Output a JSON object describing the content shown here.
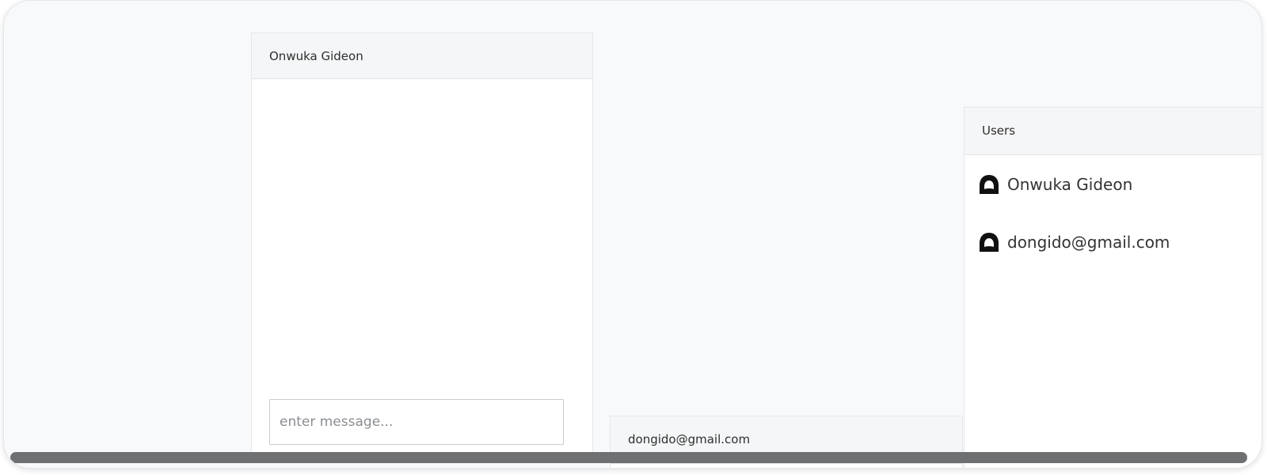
{
  "chat_window": {
    "title": "Onwuka Gideon",
    "input_placeholder": "enter message..."
  },
  "chat_window_2": {
    "title": "dongido@gmail.com"
  },
  "users_panel": {
    "title": "Users",
    "users": [
      {
        "name": "Onwuka Gideon",
        "icon": "user-avatar-icon"
      },
      {
        "name": "dongido@gmail.com",
        "icon": "user-avatar-icon"
      }
    ]
  },
  "colors": {
    "background": "#f8f9fa",
    "panel": "#ffffff",
    "header": "#f5f6f7",
    "scrollbar": "#6f7072"
  }
}
